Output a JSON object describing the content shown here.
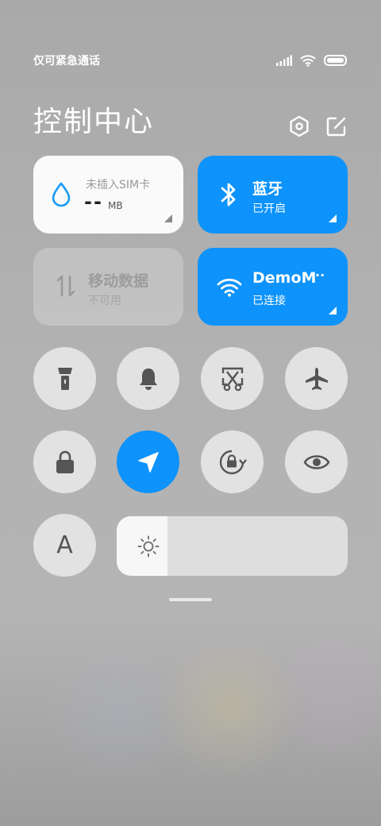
{
  "status_bar": {
    "carrier_text": "仅可紧急通话",
    "icons": [
      "signal-icon",
      "wifi-icon",
      "battery-icon"
    ]
  },
  "header": {
    "title": "控制中心",
    "settings_icon": "settings-hex-icon",
    "edit_icon": "edit-icon"
  },
  "tiles": {
    "data_usage": {
      "label": "未插入SIM卡",
      "value": "--",
      "unit": "MB",
      "icon": "water-drop-icon",
      "color": "#1a9bf5"
    },
    "bluetooth": {
      "label": "蓝牙",
      "status": "已开启",
      "icon": "bluetooth-icon",
      "color": "#0d93fb"
    },
    "mobile_data": {
      "label": "移动数据",
      "status": "不可用",
      "icon": "data-arrows-icon"
    },
    "wifi": {
      "label": "DemoM",
      "ellipsis": "··",
      "status": "已连接",
      "icon": "wifi-icon",
      "color": "#0d93fb"
    }
  },
  "toggles": [
    {
      "name": "flashlight",
      "icon": "flashlight-icon",
      "active": false
    },
    {
      "name": "ringer",
      "icon": "bell-icon",
      "active": false
    },
    {
      "name": "screenshot",
      "icon": "screenshot-scissors-icon",
      "active": false
    },
    {
      "name": "airplane-mode",
      "icon": "airplane-icon",
      "active": false
    },
    {
      "name": "lock-screen",
      "icon": "lock-icon",
      "active": false
    },
    {
      "name": "location",
      "icon": "location-arrow-icon",
      "active": true
    },
    {
      "name": "rotation-lock",
      "icon": "rotation-lock-icon",
      "active": false
    },
    {
      "name": "reading-mode",
      "icon": "eye-icon",
      "active": false
    },
    {
      "name": "auto-brightness",
      "icon": "letter-a-icon",
      "active": false
    }
  ],
  "auto_brightness_letter": "A",
  "brightness": {
    "level": 0.22,
    "icon": "sun-icon"
  },
  "colors": {
    "accent": "#0d93fb",
    "toggle_bg": "#e2e2e2",
    "icon_dark": "#555555"
  }
}
